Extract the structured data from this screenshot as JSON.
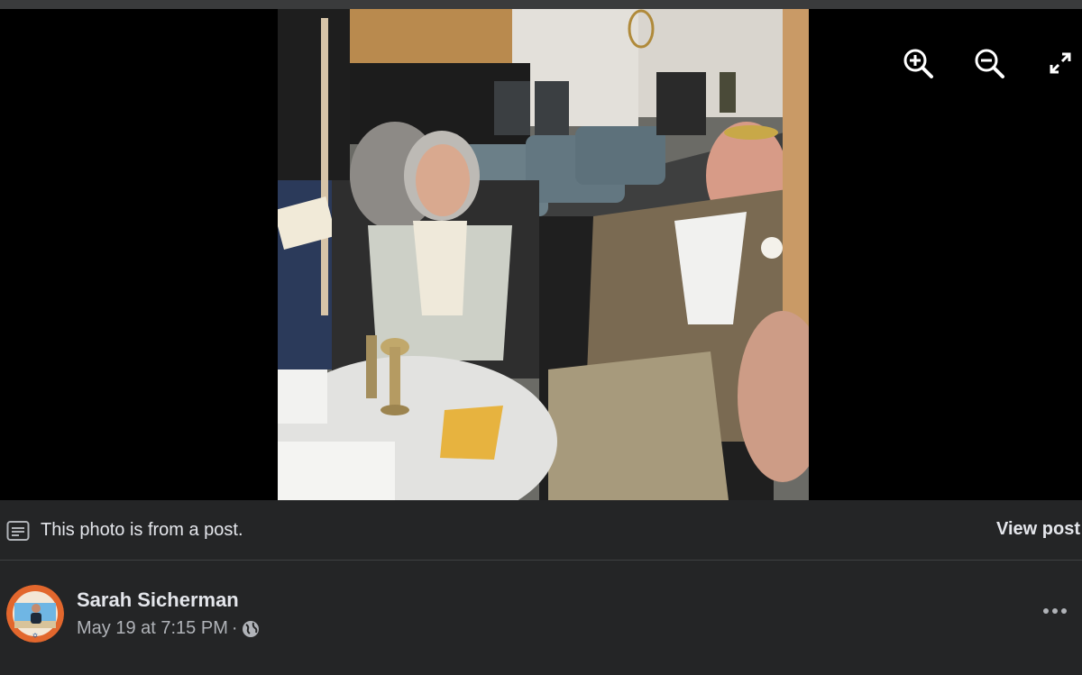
{
  "viewer": {
    "controls": [
      {
        "name": "zoom-in-icon"
      },
      {
        "name": "zoom-out-icon"
      },
      {
        "name": "fullscreen-icon"
      }
    ]
  },
  "notice": {
    "text": "This photo is from a post.",
    "view_post_label": "View post",
    "icon": "post-icon"
  },
  "post": {
    "author": "Sarah Sicherman",
    "timestamp": "May 19 at 7:15 PM",
    "separator": "·",
    "privacy_icon": "globe-icon",
    "more_icon": "more-options-icon"
  },
  "colors": {
    "viewer_bg": "#000000",
    "panel_bg": "#242526",
    "text_primary": "#e4e6eb",
    "text_secondary": "#b0b3b8"
  }
}
